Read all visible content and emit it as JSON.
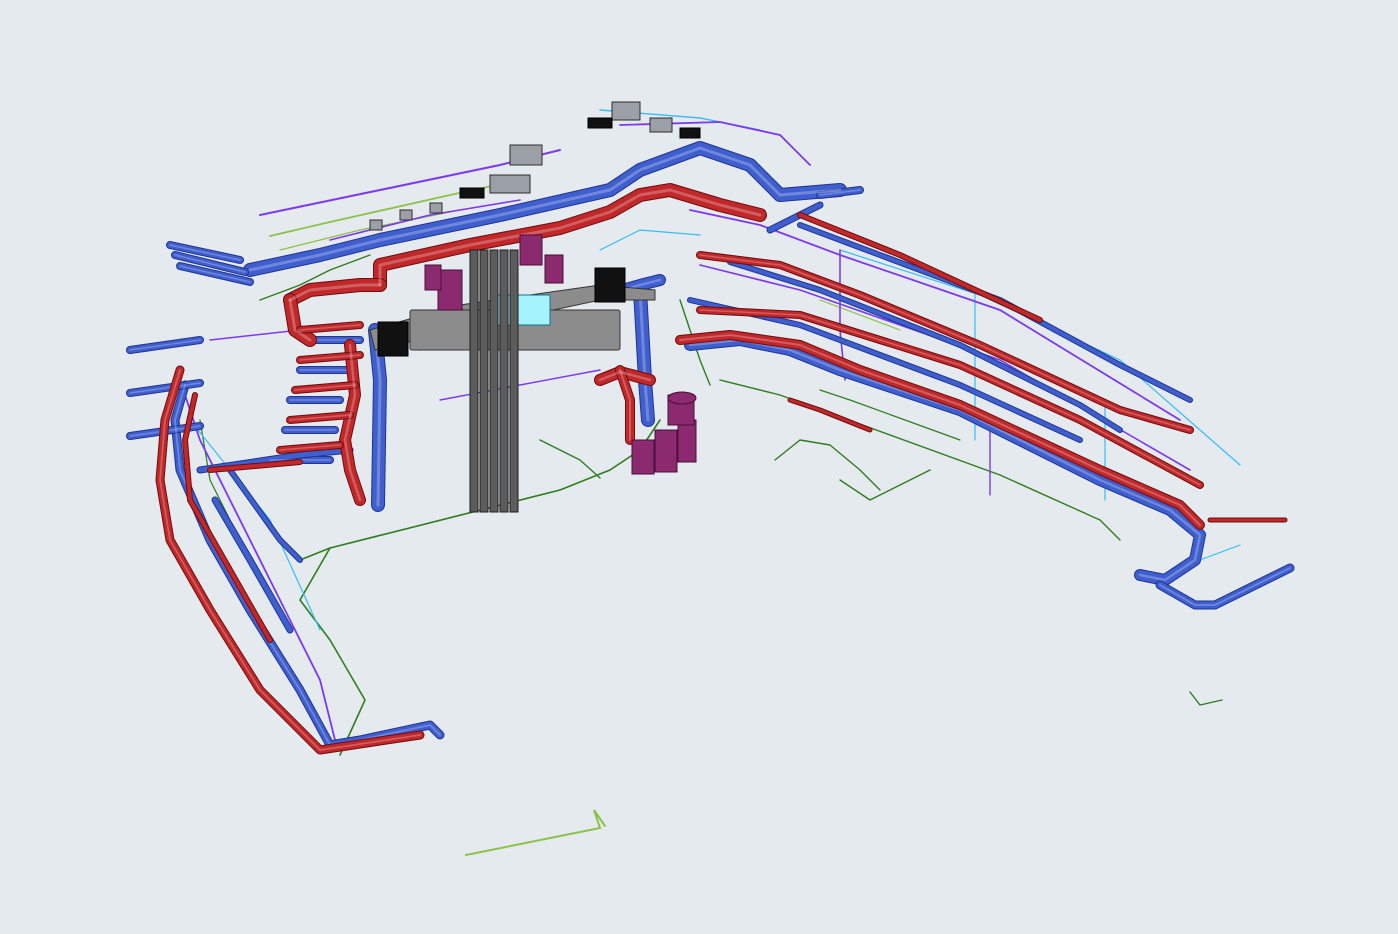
{
  "view": {
    "background": "#e4eaed"
  },
  "colors": {
    "supply_duct": "#3f5fcf",
    "supply_duct_dark": "#1f3590",
    "return_duct": "#c0282a",
    "return_duct_dark": "#6e0d0f",
    "pipe_green": "#2e7d1e",
    "pipe_light_green": "#8bc34a",
    "pipe_purple": "#7c3aed",
    "pipe_light_blue": "#38bdf8",
    "pipe_dark_blue": "#1e3a8a",
    "equipment_gray": "#8c8c8c",
    "equipment_black": "#111111",
    "equipment_cyan": "#a5f3fc",
    "equipment_magenta": "#8b2a6e"
  },
  "systems": [
    {
      "name": "supply-air-ducts",
      "color_key": "supply_duct"
    },
    {
      "name": "return-air-ducts",
      "color_key": "return_duct"
    },
    {
      "name": "chilled-water-piping",
      "color_key": "pipe_purple"
    },
    {
      "name": "condensate-piping",
      "color_key": "pipe_green"
    },
    {
      "name": "domestic-water-piping",
      "color_key": "pipe_light_blue"
    },
    {
      "name": "vertical-risers",
      "color_key": "equipment_gray"
    },
    {
      "name": "air-handling-units",
      "color_key": "equipment_gray"
    },
    {
      "name": "shaft-equipment",
      "color_key": "equipment_magenta"
    }
  ]
}
